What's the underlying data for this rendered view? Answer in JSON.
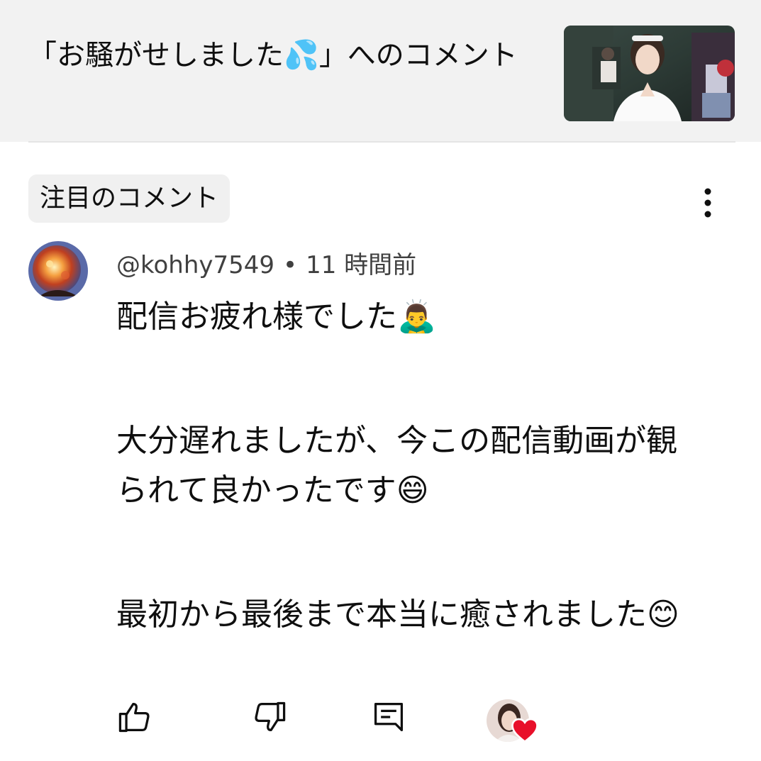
{
  "header": {
    "title_prefix": "「お騒がせしました",
    "title_emoji": "💦",
    "title_suffix": "」へのコメント"
  },
  "filter_chip": {
    "label": "注目のコメント"
  },
  "comment": {
    "author": "@kohhy7549",
    "separator": "•",
    "time": "11 時間前",
    "paragraphs": [
      {
        "text": "配信お疲れ様でした",
        "emoji": "🙇‍♂️"
      },
      {
        "text": "大分遅れましたが、今この配信動画が観られて良かったです",
        "emoji": "😄"
      },
      {
        "text": "最初から最後まで本当に癒されました",
        "emoji": "😊"
      }
    ]
  },
  "actions": {
    "like_icon": "thumbs-up-icon",
    "dislike_icon": "thumbs-down-icon",
    "reply_icon": "reply-comment-icon",
    "creator_heart_icon": "creator-heart-icon"
  },
  "colors": {
    "header_bg": "#f2f2f2",
    "chip_bg": "#f0f0f0",
    "text": "#0f0f0f",
    "meta_text": "#404040",
    "heart": "#e8102a"
  }
}
